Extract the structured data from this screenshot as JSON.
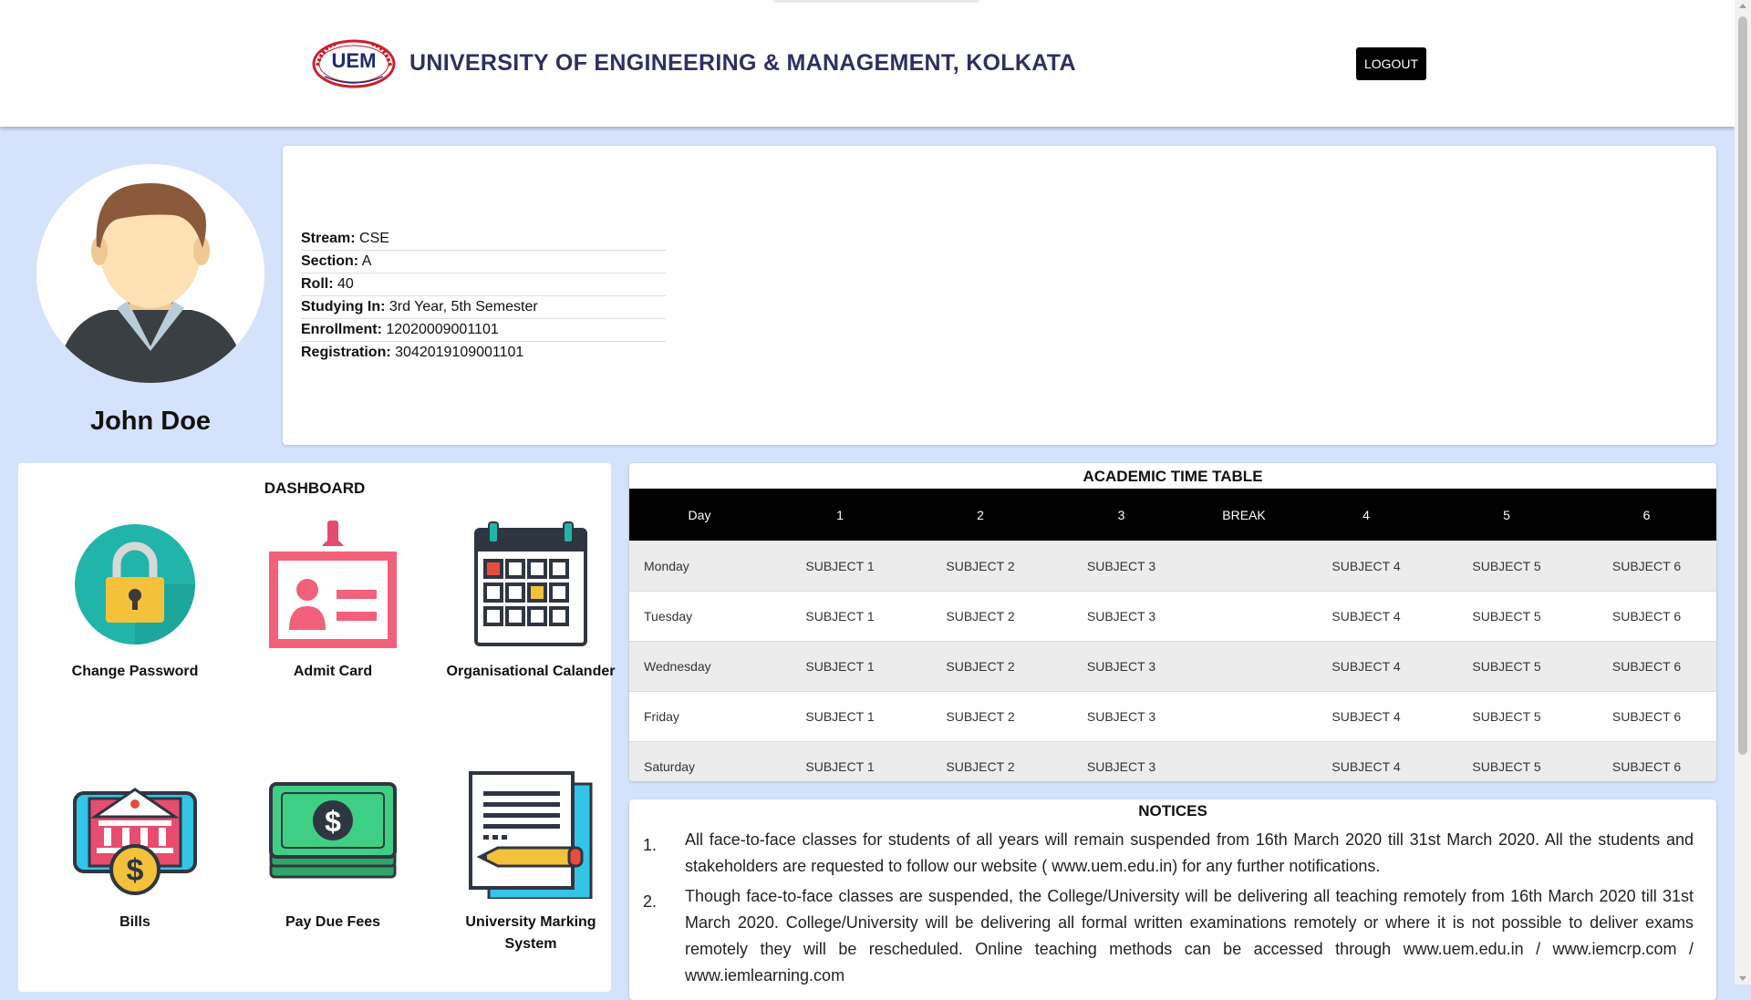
{
  "header": {
    "logo_text": "UEM",
    "university_name": "UNIVERSITY OF ENGINEERING & MANAGEMENT, KOLKATA",
    "logout_label": "LOGOUT"
  },
  "profile": {
    "name": "John Doe",
    "info": [
      {
        "label": "Stream:",
        "value": "CSE"
      },
      {
        "label": "Section:",
        "value": "A"
      },
      {
        "label": "Roll:",
        "value": "40"
      },
      {
        "label": "Studying In:",
        "value": "3rd Year, 5th Semester"
      },
      {
        "label": "Enrollment:",
        "value": "12020009001101"
      },
      {
        "label": "Registration:",
        "value": "3042019109001101"
      }
    ]
  },
  "dashboard": {
    "title": "DASHBOARD",
    "tiles": [
      {
        "label": "Change Password",
        "icon": "lock-icon"
      },
      {
        "label": "Admit Card",
        "icon": "id-card-icon"
      },
      {
        "label": "Organisational Calander",
        "icon": "calendar-icon"
      },
      {
        "label": "Bills",
        "icon": "bill-icon"
      },
      {
        "label": "Pay Due Fees",
        "icon": "cash-icon"
      },
      {
        "label": "University Marking System",
        "icon": "document-pencil-icon"
      }
    ]
  },
  "timetable": {
    "title": "ACADEMIC TIME TABLE",
    "headers": [
      "Day",
      "1",
      "2",
      "3",
      "BREAK",
      "4",
      "5",
      "6"
    ],
    "rows": [
      [
        "Monday",
        "SUBJECT 1",
        "SUBJECT 2",
        "SUBJECT 3",
        "",
        "SUBJECT 4",
        "SUBJECT 5",
        "SUBJECT 6"
      ],
      [
        "Tuesday",
        "SUBJECT 1",
        "SUBJECT 2",
        "SUBJECT 3",
        "",
        "SUBJECT 4",
        "SUBJECT 5",
        "SUBJECT 6"
      ],
      [
        "Wednesday",
        "SUBJECT 1",
        "SUBJECT 2",
        "SUBJECT 3",
        "",
        "SUBJECT 4",
        "SUBJECT 5",
        "SUBJECT 6"
      ],
      [
        "Friday",
        "SUBJECT 1",
        "SUBJECT 2",
        "SUBJECT 3",
        "",
        "SUBJECT 4",
        "SUBJECT 5",
        "SUBJECT 6"
      ],
      [
        "Saturday",
        "SUBJECT 1",
        "SUBJECT 2",
        "SUBJECT 3",
        "",
        "SUBJECT 4",
        "SUBJECT 5",
        "SUBJECT 6"
      ]
    ]
  },
  "notices": {
    "title": "NOTICES",
    "items": [
      {
        "num": "1.",
        "text": "All face-to-face classes for students of all years will remain suspended from 16th March 2020 till 31st March 2020. All the students and stakeholders are requested to follow our website ( www.uem.edu.in) for any further notifications."
      },
      {
        "num": "2.",
        "text": "Though face-to-face classes are suspended, the College/University will be delivering all teaching remotely from 16th March 2020 till 31st March 2020. College/University will be delivering all formal written examinations remotely or where it is not possible to deliver exams remotely they will be rescheduled. Online teaching methods can be accessed through www.uem.edu.in / www.iemcrp.com / www.iemlearning.com"
      }
    ]
  },
  "colors": {
    "page_background": "#d4e3fb",
    "title_color": "#2f3061",
    "header_row": "#000000",
    "logo_red": "#c8202c"
  }
}
